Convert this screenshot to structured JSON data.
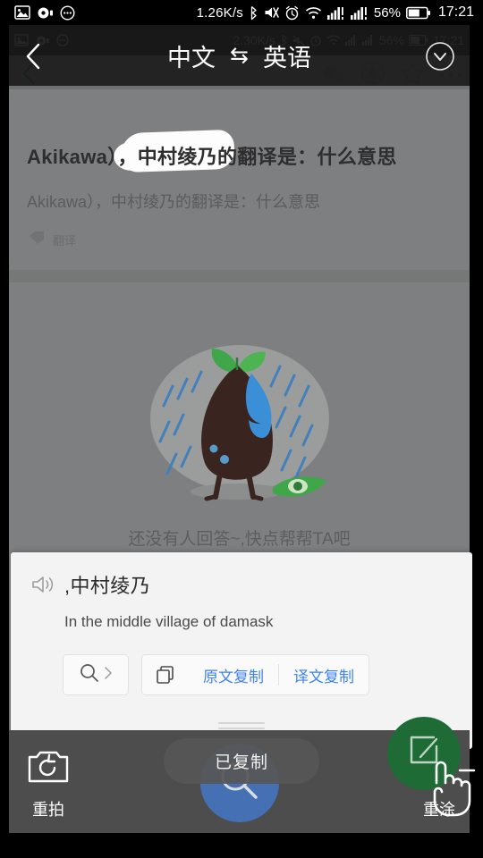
{
  "status_bar": {
    "icons_left": [
      "image-icon",
      "camera-icon",
      "more-circle-icon"
    ],
    "network_speed": "1.26K/s",
    "icons_right": [
      "bluetooth-icon",
      "mute-icon",
      "alarm-icon",
      "wifi-icon",
      "signal-1-icon",
      "signal-2-icon"
    ],
    "battery_percent": "56%",
    "time": "17:21"
  },
  "app_status_bar": {
    "network_speed": "2.30K/s",
    "battery_percent": "56%",
    "time": "17:21"
  },
  "translate_header": {
    "back_label": "back-chevron",
    "source_language": "中文",
    "swap_symbol": "⇆",
    "target_language": "英语",
    "collapse_label": "collapse"
  },
  "background_app": {
    "question_title": "Akikawa），中村绫乃的翻译是：什么意思",
    "question_subtitle": "Akikawa），中村绫乃的翻译是：什么意思",
    "tag_label": "翻译",
    "empty_state_text": "还没有人回答~,快点帮帮TA吧",
    "toolbar_icons": [
      "comment-icon",
      "shutter-icon",
      "star-icon",
      "more-icon"
    ]
  },
  "translation_card": {
    "speaker_icon": "speaker-icon",
    "source_text": ",中村绫乃",
    "translated_text": "In the middle village of damask",
    "search_button_label": "search",
    "copy_icon": "copy-icon",
    "copy_source_label": "原文复制",
    "copy_translation_label": "译文复制",
    "accent_color": "#3e83ef"
  },
  "toast": {
    "message": "已复制"
  },
  "bottom_bar": {
    "retake_label": "重拍",
    "retake_icon": "camera-retake-icon",
    "search_fab_icon": "search-icon",
    "search_fab_color": "#4571b4",
    "repaint_label": "重涂",
    "repaint_icon": "edit-square-icon",
    "repaint_fab_color": "#1f6b36",
    "cursor_icon": "pointing-hand-cursor"
  }
}
